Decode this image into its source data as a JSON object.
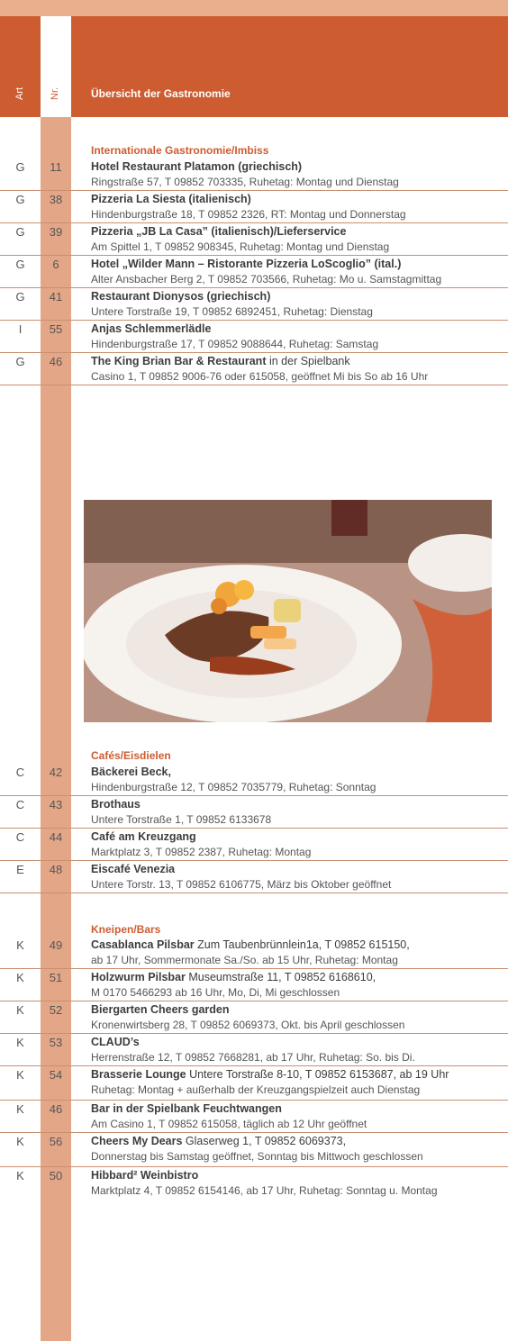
{
  "header": {
    "col_art": "Art",
    "col_nr": "Nr.",
    "title": "Übersicht der Gastronomie"
  },
  "sections": [
    {
      "title": "Internationale Gastronomie/Imbiss"
    },
    {
      "title": "Cafés/Eisdielen"
    },
    {
      "title": "Kneipen/Bars"
    }
  ],
  "rows": [
    {
      "art": "G",
      "nr": "11",
      "title": "Hotel Restaurant Platamon (griechisch)",
      "extra": "",
      "detail": "Ringstraße 57, T 09852 703335, Ruhetag: Montag und Dienstag",
      "detail2": ""
    },
    {
      "art": "G",
      "nr": "38",
      "title": "Pizzeria La Siesta (italienisch)",
      "extra": "",
      "detail": "Hindenburgstraße 18, T 09852 2326, RT: Montag und Donnerstag",
      "detail2": ""
    },
    {
      "art": "G",
      "nr": "39",
      "title": "Pizzeria „JB La Casa” (italienisch)/Lieferservice",
      "extra": "",
      "detail": "Am Spittel 1, T 09852 908345, Ruhetag: Montag und Dienstag",
      "detail2": ""
    },
    {
      "art": "G",
      "nr": "6",
      "title": "Hotel „Wilder Mann – Ristorante Pizzeria LoScoglio” (ital.)",
      "extra": "",
      "detail": "Alter Ansbacher Berg 2, T 09852 703566, Ruhetag: Mo u. Samstagmittag",
      "detail2": ""
    },
    {
      "art": "G",
      "nr": "41",
      "title": "Restaurant Dionysos (griechisch)",
      "extra": "",
      "detail": "Untere Torstraße 19, T 09852 6892451, Ruhetag: Dienstag",
      "detail2": ""
    },
    {
      "art": "I",
      "nr": "55",
      "title": "Anjas Schlemmerlädle",
      "extra": "",
      "detail": "Hindenburgstraße 17, T 09852 9088644, Ruhetag: Samstag",
      "detail2": ""
    },
    {
      "art": "G",
      "nr": "46",
      "title": "The King Brian Bar & Restaurant",
      "extra": " in der Spielbank",
      "detail": "Casino 1, T 09852 9006-76 oder 615058, geöffnet Mi bis So ab 16 Uhr",
      "detail2": ""
    },
    {
      "art": "C",
      "nr": "42",
      "title": "Bäckerei Beck,",
      "extra": "",
      "detail": "Hindenburgstraße 12, T 09852 7035779, Ruhetag: Sonntag",
      "detail2": ""
    },
    {
      "art": "C",
      "nr": "43",
      "title": "Brothaus",
      "extra": "",
      "detail": "Untere Torstraße 1, T 09852 6133678",
      "detail2": ""
    },
    {
      "art": "C",
      "nr": "44",
      "title": "Café am Kreuzgang",
      "extra": "",
      "detail": "Marktplatz 3, T 09852 2387, Ruhetag: Montag",
      "detail2": ""
    },
    {
      "art": "E",
      "nr": "48",
      "title": "Eiscafé Venezia",
      "extra": "",
      "detail": "Untere Torstr. 13, T 09852 6106775, März bis Oktober geöffnet",
      "detail2": ""
    },
    {
      "art": "K",
      "nr": "49",
      "title": "Casablanca Pilsbar",
      "extra": " Zum Taubenbrünnlein1a, T 09852 615150,",
      "detail": "ab 17 Uhr, Sommermonate Sa./So. ab 15 Uhr, Ruhetag: Montag",
      "detail2": ""
    },
    {
      "art": "K",
      "nr": "51",
      "title": "Holzwurm Pilsbar",
      "extra": " Museumstraße 11, T 09852 6168610,",
      "detail": "M 0170 5466293 ab 16 Uhr, Mo, Di, Mi geschlossen",
      "detail2": ""
    },
    {
      "art": "K",
      "nr": "52",
      "title": "Biergarten Cheers garden",
      "extra": "",
      "detail": "Kronenwirtsberg 28, T 09852 6069373, Okt. bis April geschlossen",
      "detail2": ""
    },
    {
      "art": "K",
      "nr": "53",
      "title": "CLAUD’s",
      "extra": "",
      "detail": "Herrenstraße 12, T 09852 7668281, ab 17 Uhr,  Ruhetag: So. bis Di.",
      "detail2": ""
    },
    {
      "art": "K",
      "nr": "54",
      "title": "Brasserie Lounge",
      "extra": " Untere Torstraße 8-10, T 09852 6153687, ab 19 Uhr",
      "detail": "Ruhetag: Montag + außerhalb der Kreuzgangspielzeit auch Dienstag",
      "detail2": ""
    },
    {
      "art": "K",
      "nr": "46",
      "title": "Bar in der Spielbank Feuchtwangen",
      "extra": "",
      "detail": "Am Casino 1, T 09852 615058, täglich ab 12 Uhr geöffnet",
      "detail2": ""
    },
    {
      "art": "K",
      "nr": "56",
      "title": "Cheers My Dears",
      "extra": " Glaserweg 1, T 09852 6069373,",
      "detail": "Donnerstag bis Samstag geöffnet, Sonntag bis Mittwoch geschlossen",
      "detail2": ""
    },
    {
      "art": "K",
      "nr": "50",
      "title": "Hibbard² Weinbistro",
      "extra": "",
      "detail": "Marktplatz 4, T 09852 6154146, ab 17 Uhr, Ruhetag: Sonntag u. Montag",
      "detail2": ""
    }
  ]
}
